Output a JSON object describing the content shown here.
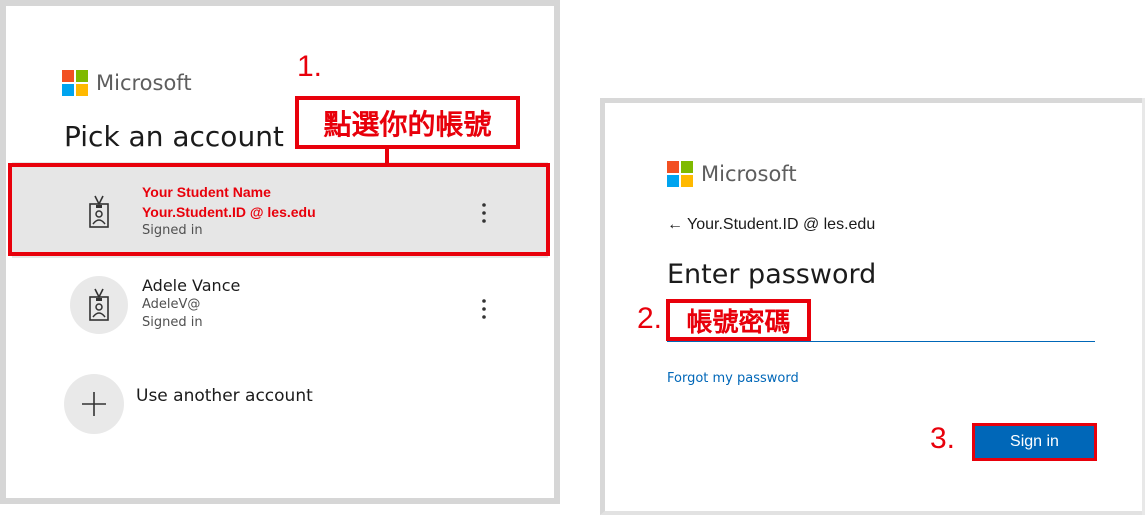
{
  "left": {
    "brand": "Microsoft",
    "title": "Pick an account",
    "accounts": [
      {
        "name": "Your Student Name",
        "id": "Your.Student.ID @ les.edu",
        "status": "Signed in"
      },
      {
        "name": "Adele Vance",
        "id": "AdeleV@",
        "status": "Signed in"
      }
    ],
    "use_another": "Use another account",
    "more_glyph": "⋮"
  },
  "right": {
    "brand": "Microsoft",
    "back_arrow": "←",
    "email": "Your.Student.ID @ les.edu",
    "title": "Enter password",
    "forgot": "Forgot my password",
    "sign_in": "Sign in"
  },
  "annotations": {
    "step1_num": "1.",
    "step1_text": "點選你的帳號",
    "step2_num": "2.",
    "step2_text": "帳號密碼",
    "step3_num": "3."
  },
  "colors": {
    "accent_red": "#e8000b",
    "button_blue": "#0067b8",
    "link_blue": "#0067b8",
    "selected_row": "#e6e6e6"
  },
  "icons": [
    "microsoft-logo-icon",
    "id-badge-icon",
    "plus-icon",
    "more-vertical-icon",
    "back-arrow-icon"
  ]
}
